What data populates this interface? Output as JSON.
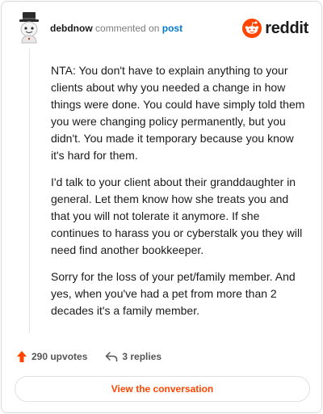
{
  "header": {
    "username": "debdnow",
    "action_text": "commented on",
    "target_text": "post",
    "brand": "reddit"
  },
  "comment": {
    "paragraphs": [
      "NTA: You don't have to explain anything to your clients about why you needed a change in how things were done. You could have simply told them you were changing policy permanently, but you didn't. You made it temporary because you know it's hard for them.",
      "I'd talk to your client about their granddaughter in general. Let them know how she treats you and that you will not tolerate it anymore. If she continues to harass you or cyberstalk you they will need find another bookkeeper.",
      "Sorry for the loss of your pet/family member. And yes, when you've had a pet from more than 2 decades it's a family member."
    ]
  },
  "actions": {
    "upvotes": "290 upvotes",
    "replies": "3 replies"
  },
  "footer": {
    "view_button": "View the conversation"
  },
  "colors": {
    "reddit_orange": "#ff4500",
    "link_blue": "#0079d3",
    "muted": "#7c7c7c"
  },
  "icons": [
    "avatar-icon",
    "reddit-logo-icon",
    "upvote-arrow-icon",
    "reply-icon"
  ]
}
